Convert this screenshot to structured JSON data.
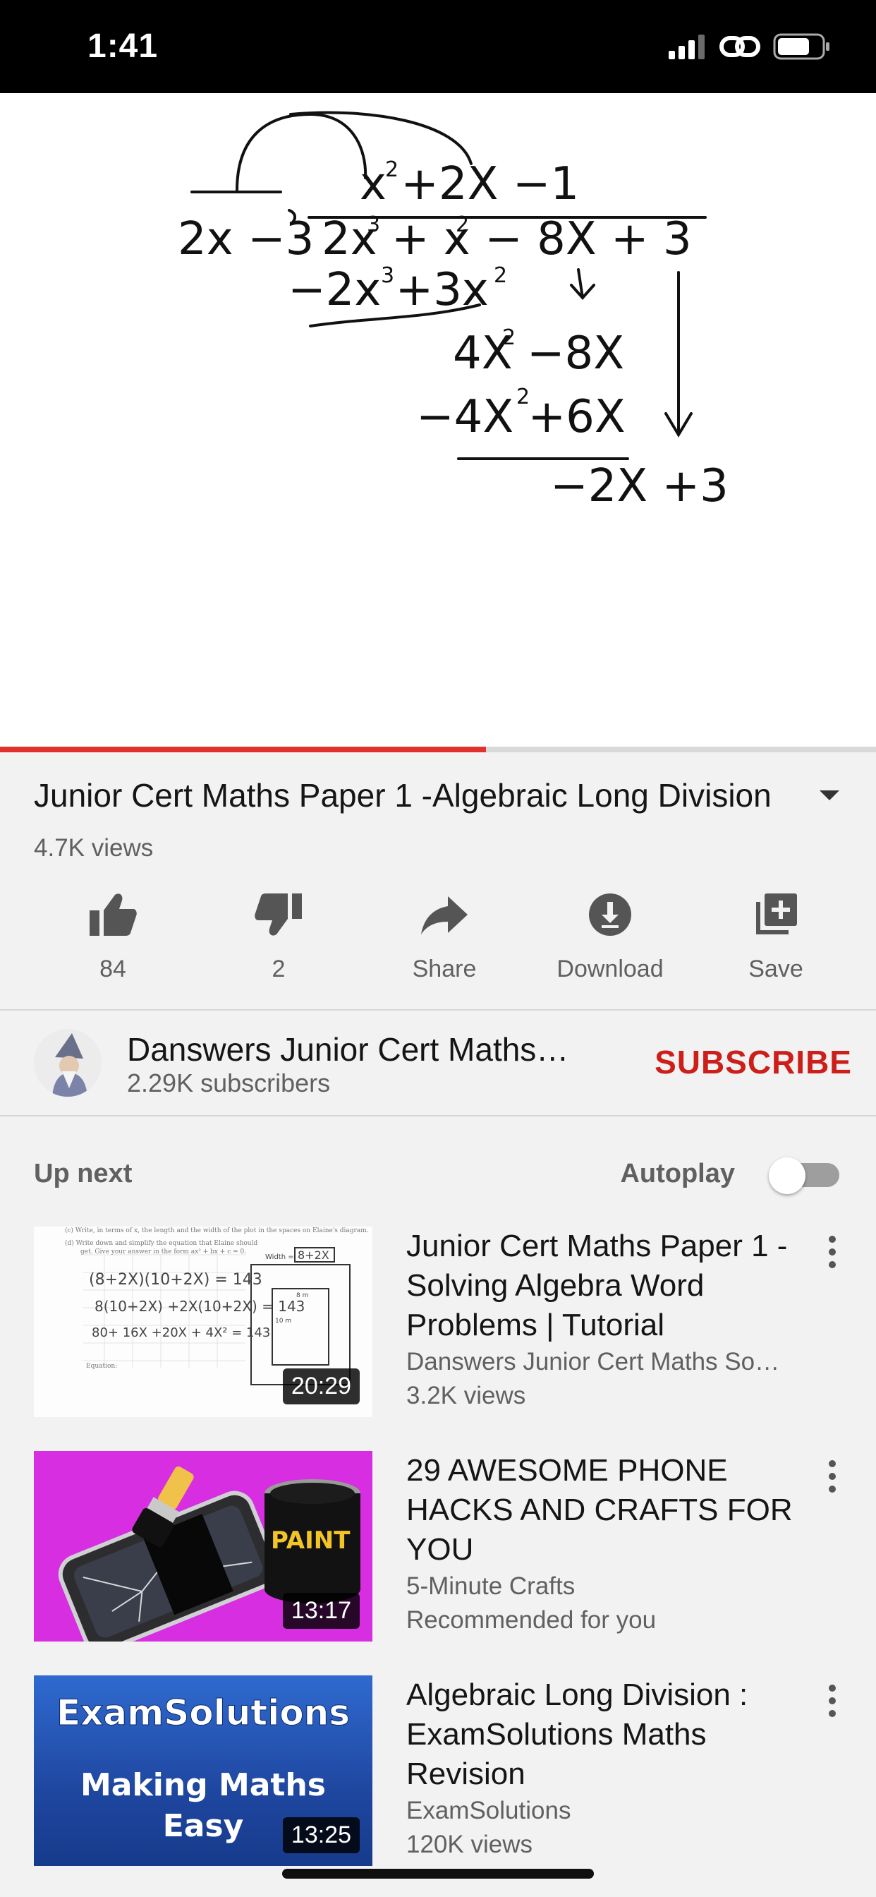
{
  "status_bar": {
    "time": "1:41"
  },
  "player": {
    "progress_fraction": 0.555
  },
  "video": {
    "title": "Junior Cert Maths Paper 1 -Algebraic Long Division",
    "views": "4.7K views"
  },
  "actions": [
    {
      "icon": "thumbs-up-icon",
      "label": "84"
    },
    {
      "icon": "thumbs-down-icon",
      "label": "2"
    },
    {
      "icon": "share-icon",
      "label": "Share"
    },
    {
      "icon": "download-icon",
      "label": "Download"
    },
    {
      "icon": "save-playlist-icon",
      "label": "Save"
    }
  ],
  "channel": {
    "name": "Danswers Junior Cert Maths…",
    "subscribers": "2.29K subscribers",
    "subscribe_label": "SUBSCRIBE"
  },
  "up_next": {
    "label": "Up next",
    "autoplay_label": "Autoplay",
    "autoplay_on": false
  },
  "videos": [
    {
      "title": "Junior Cert Maths Paper 1 -  Solving Algebra Word Problems | Tutorial",
      "channel": "Danswers Junior Cert Maths So…",
      "detail": "3.2K views",
      "duration": "20:29"
    },
    {
      "title": "29 AWESOME PHONE HACKS AND CRAFTS FOR YOU",
      "channel": "5-Minute Crafts",
      "detail": "Recommended for you",
      "duration": "13:17",
      "thumb_text": "PAINT"
    },
    {
      "title": "Algebraic Long Division : ExamSolutions Maths Revision",
      "channel": "ExamSolutions",
      "detail": "120K views",
      "duration": "13:25",
      "thumb_line1": "ExamSolutions",
      "thumb_line2": "Making Maths",
      "thumb_line3": "Easy"
    }
  ],
  "colors": {
    "accent": "#cc1f1a",
    "progress": "#e0312c",
    "crafts_bg": "#d62ee0",
    "exam_bg": "#2a58b8"
  }
}
